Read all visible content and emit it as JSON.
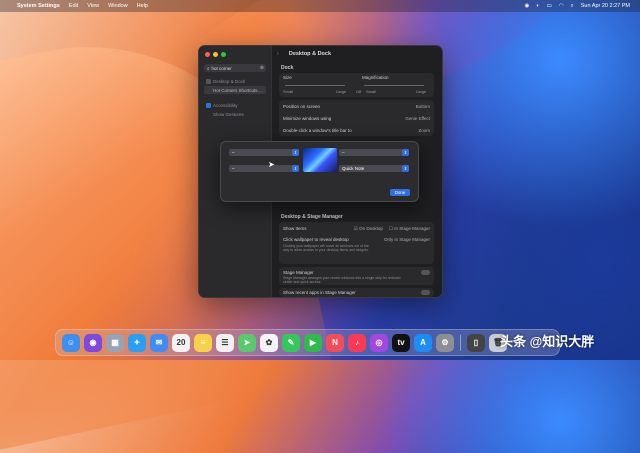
{
  "menubar": {
    "app_name": "System Settings",
    "items": [
      "Edit",
      "View",
      "Window",
      "Help"
    ],
    "datetime": "Sun Apr 20  2:27 PM"
  },
  "window": {
    "title": "Desktop & Dock",
    "sidebar": {
      "search_value": "hot corner",
      "items": [
        {
          "label": "Desktop & Dock"
        },
        {
          "label": "Hot Corners Shortcuts…"
        },
        {
          "label": "Accessibility"
        },
        {
          "label": "Show Gestures"
        }
      ]
    },
    "dock_section": {
      "header": "Dock",
      "size_label": "Size",
      "magnification_label": "Magnification",
      "small": "Small",
      "large": "Large",
      "off": "Off",
      "small2": "Small",
      "large2": "Large",
      "rows": [
        {
          "label": "Position on screen",
          "value": "Bottom"
        },
        {
          "label": "Minimize windows using",
          "value": "Genie Effect"
        },
        {
          "label": "Double-click a window's title bar to",
          "value": "Zoom"
        }
      ]
    },
    "stage_section": {
      "header": "Desktop & Stage Manager",
      "show_items_label": "Show Items",
      "on_desktop": "On Desktop",
      "in_stage_manager": "In Stage Manager",
      "click_wallpaper_label": "Click wallpaper to reveal desktop",
      "click_wallpaper_value": "Only in Stage Manager",
      "click_wallpaper_desc": "Clicking your wallpaper will move all windows out of the way to allow access to your desktop items and widgets.",
      "stage_manager_label": "Stage Manager",
      "stage_manager_desc": "Stage Manager arranges your recent windows into a single strip for reduced clutter and quick access.",
      "show_recent_label": "Show recent apps in Stage Manager"
    }
  },
  "dialog": {
    "dropdown_tl": "–",
    "dropdown_tr": "–",
    "dropdown_bl": "–",
    "dropdown_br": "Quick Note",
    "done_label": "Done"
  },
  "dock": {
    "icons": [
      {
        "name": "finder-icon",
        "glyph": "☺",
        "color": "#3d8ff0"
      },
      {
        "name": "siri-icon",
        "glyph": "◉",
        "color": "#7b4be0"
      },
      {
        "name": "launchpad-icon",
        "glyph": "▦",
        "color": "#9aa3b5"
      },
      {
        "name": "safari-icon",
        "glyph": "✦",
        "color": "#2a9df4"
      },
      {
        "name": "mail-icon",
        "glyph": "✉",
        "color": "#3f8cf5"
      },
      {
        "name": "calendar-icon",
        "glyph": "20",
        "color": "#f2f2f2"
      },
      {
        "name": "notes-icon",
        "glyph": "≡",
        "color": "#f6d24b"
      },
      {
        "name": "reminders-icon",
        "glyph": "☰",
        "color": "#f0f0f0"
      },
      {
        "name": "maps-icon",
        "glyph": "➤",
        "color": "#5ac86c"
      },
      {
        "name": "photos-icon",
        "glyph": "✿",
        "color": "#f4f4f4"
      },
      {
        "name": "messages-icon",
        "glyph": "✎",
        "color": "#34c759"
      },
      {
        "name": "facetime-icon",
        "glyph": "▶",
        "color": "#30b94d"
      },
      {
        "name": "news-icon",
        "glyph": "N",
        "color": "#f44d5a"
      },
      {
        "name": "music-icon",
        "glyph": "♪",
        "color": "#fa3a55"
      },
      {
        "name": "podcasts-icon",
        "glyph": "◎",
        "color": "#a248e0"
      },
      {
        "name": "tv-icon",
        "glyph": "tv",
        "color": "#111111"
      },
      {
        "name": "app-store-icon",
        "glyph": "A",
        "color": "#1e8cf5"
      },
      {
        "name": "system-settings-icon",
        "glyph": "⚙",
        "color": "#8e8e93"
      },
      {
        "name": "iphone-mirroring-icon",
        "glyph": "▯",
        "color": "#444"
      },
      {
        "name": "trash-icon",
        "glyph": "🗑",
        "color": "#c9ccd4"
      }
    ]
  },
  "watermark": "头条 @知识大胖"
}
